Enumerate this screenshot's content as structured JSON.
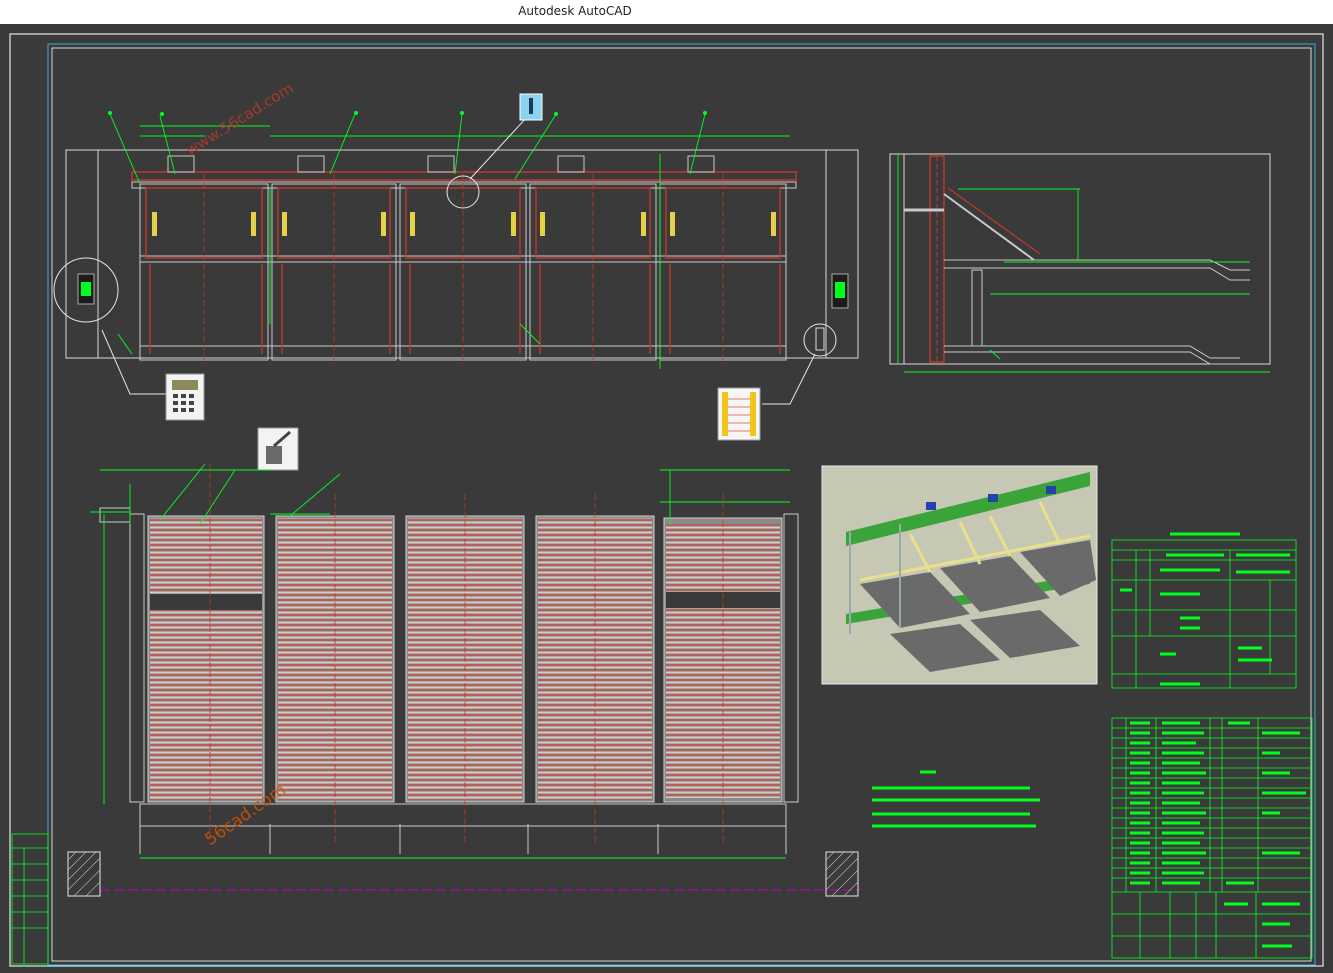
{
  "window": {
    "title": "Autodesk AutoCAD"
  },
  "drawing": {
    "watermark_1": "www.56cad.com",
    "watermark_2": "56cad.com",
    "colors": {
      "background": "#3a3a3a",
      "frame": "#ffffff",
      "outline": "#25b8e0",
      "geometry": "#00ff1e",
      "steel": "#c9c9c9",
      "dimension_red": "#c0392b",
      "magenta_line": "#c000c0"
    },
    "views": [
      "front-elevation",
      "side-elevation",
      "top-plan",
      "isometric-render"
    ],
    "icons": [
      "lift-button-icon",
      "card-reader-keypad-icon",
      "light-curtain-sensor-icon",
      "limit-switch-icon"
    ]
  }
}
